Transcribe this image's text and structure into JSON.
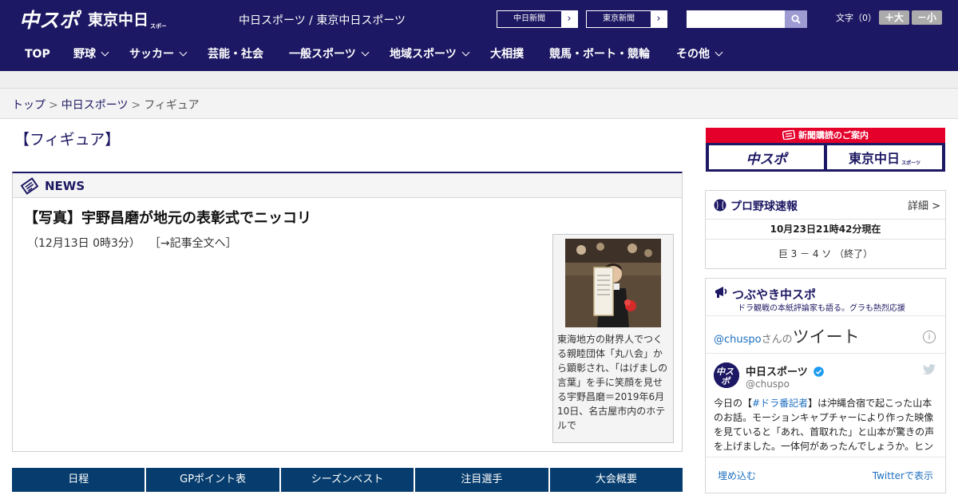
{
  "header": {
    "logo_chuspo": "中スポ",
    "logo_tokyo": "東京中日",
    "logo_tokyo_sub": "スポーツ",
    "site_name": "中日スポーツ / 東京中日スポーツ",
    "links": [
      {
        "label": "中日新聞",
        "arrow": "›"
      },
      {
        "label": "東京新聞",
        "arrow": "›"
      }
    ],
    "search": {
      "placeholder": "",
      "icon": "search-icon"
    },
    "font_size_label": "文字（0）",
    "font_plus": "＋大",
    "font_minus": "－小"
  },
  "nav": [
    {
      "label": "TOP",
      "has_menu": false
    },
    {
      "label": "野球",
      "has_menu": true
    },
    {
      "label": "サッカー",
      "has_menu": true
    },
    {
      "label": "芸能・社会",
      "has_menu": false
    },
    {
      "label": "一般スポーツ",
      "has_menu": true
    },
    {
      "label": "地域スポーツ",
      "has_menu": true
    },
    {
      "label": "大相撲",
      "has_menu": false
    },
    {
      "label": "競馬・ボート・競輪",
      "has_menu": false
    },
    {
      "label": "その他",
      "has_menu": true
    }
  ],
  "breadcrumb": {
    "home": "トップ",
    "section": "中日スポーツ",
    "current": "フィギュア",
    "sep": ">"
  },
  "page_title": "【フィギュア】",
  "news": {
    "label": "NEWS",
    "article_title": "【写真】宇野昌磨が地元の表彰式でニッコリ",
    "date": "（12月13日 0時3分）",
    "full_link": "［→記事全文へ］",
    "caption": "東海地方の財界人でつくる親睦団体「丸八会」から顕彰され、「はげましの言葉」を手に笑顔を見せる宇野昌磨＝2019年6月10日、名古屋市内のホテルで"
  },
  "bottom_tabs": [
    "日程",
    "GPポイント表",
    "シーズンベスト",
    "注目選手",
    "大会概要"
  ],
  "sidebar": {
    "subscription": {
      "title": "新聞購読のご案内",
      "chuspo": "中スポ",
      "tokyo": "東京中日",
      "tokyo_sub": "スポーツ"
    },
    "baseball": {
      "title": "プロ野球速報",
      "detail": "詳細 >",
      "time": "10月23日21時42分現在",
      "score": "巨  3  －  4  ソ  （終了）"
    },
    "tweets": {
      "title": "つぶやき中スポ",
      "subtitle": "ドラ観戦の本紙評論家も語る。グラも熱烈応援",
      "heading_handle": "@chuspo",
      "heading_san": "さんの",
      "heading_big": "ツイート",
      "account_name": "中日スポーツ",
      "account_handle": "@chuspo",
      "text_before": "今日の【",
      "text_tag": "#ドラ番記者",
      "text_after": "】は沖縄合宿で起こった山本のお話。モーションキャプチャーにより作った映像を見ていると「あれ、首取れた」と山本が驚きの声を上げました。一体何があったんでしょうか。ヒン",
      "embed": "埋め込む",
      "view_on_twitter": "Twitterで表示"
    }
  },
  "colors": {
    "brand_navy": "#1d1863",
    "tab_blue": "#073d6e",
    "red": "#e4002b"
  }
}
